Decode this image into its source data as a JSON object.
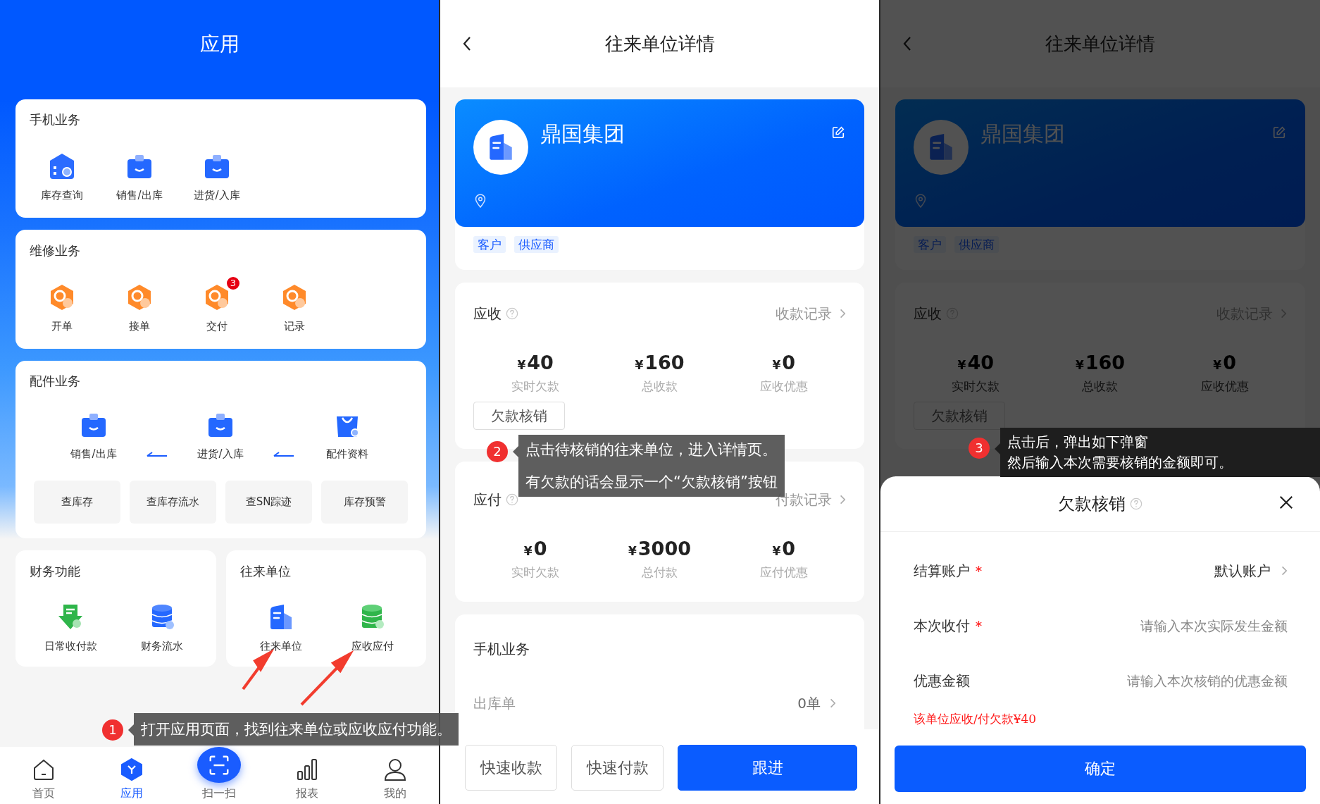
{
  "app_screen": {
    "title": "应用",
    "sections": [
      {
        "kind": "grid",
        "title": "手机业务",
        "items": [
          {
            "label": "库存查询",
            "kind": "house"
          },
          {
            "label": "销售/出库",
            "kind": "box"
          },
          {
            "label": "进货/入库",
            "kind": "box"
          }
        ]
      },
      {
        "kind": "grid",
        "title": "维修业务",
        "items": [
          {
            "label": "开单",
            "kind": "hex"
          },
          {
            "label": "接单",
            "kind": "hex"
          },
          {
            "label": "交付",
            "kind": "hex",
            "badge": "3"
          },
          {
            "label": "记录",
            "kind": "hex"
          }
        ]
      },
      {
        "kind": "flow",
        "title": "配件业务",
        "items": [
          {
            "label": "销售/出库",
            "kind": "box"
          },
          {
            "label": "进货/入库",
            "kind": "box"
          },
          {
            "label": "配件资料",
            "kind": "bag"
          }
        ],
        "buttons": [
          "查库存",
          "查库存流水",
          "查SN踪迹",
          "库存预警"
        ]
      }
    ],
    "half_sections": [
      {
        "title": "财务功能",
        "items": [
          {
            "label": "日常收付款",
            "kind": "download"
          },
          {
            "label": "财务流水",
            "kind": "database"
          }
        ]
      },
      {
        "title": "往来单位",
        "items": [
          {
            "label": "往来单位",
            "kind": "building"
          },
          {
            "label": "应收应付",
            "kind": "coins"
          }
        ]
      }
    ],
    "nav": [
      {
        "label": "首页",
        "kind": "home",
        "selected": false
      },
      {
        "label": "应用",
        "kind": "apps",
        "selected": true
      },
      {
        "label": "扫一扫",
        "kind": "scan",
        "selected": false
      },
      {
        "label": "报表",
        "kind": "chart",
        "selected": false
      },
      {
        "label": "我的",
        "kind": "user",
        "selected": false
      }
    ]
  },
  "detail_screen": {
    "title": "往来单位详情",
    "company": {
      "name": "鼎国集团",
      "tags": [
        "客户",
        "供应商"
      ]
    },
    "receivable": {
      "title": "应收",
      "link": "收款记录",
      "stats": [
        {
          "currency": "¥",
          "amount": "40",
          "label": "实时欠款"
        },
        {
          "currency": "¥",
          "amount": "160",
          "label": "总收款"
        },
        {
          "currency": "¥",
          "amount": "0",
          "label": "应收优惠"
        }
      ],
      "action": "欠款核销"
    },
    "payable": {
      "title": "应付",
      "link": "付款记录",
      "stats": [
        {
          "currency": "¥",
          "amount": "0",
          "label": "实时欠款"
        },
        {
          "currency": "¥",
          "amount": "3000",
          "label": "总付款"
        },
        {
          "currency": "¥",
          "amount": "0",
          "label": "应付优惠"
        }
      ]
    },
    "business": {
      "title": "手机业务",
      "rows": [
        {
          "label": "出库单",
          "value": "0单"
        }
      ]
    },
    "buttons": [
      {
        "label": "快速收款",
        "primary": false
      },
      {
        "label": "快速付款",
        "primary": false
      },
      {
        "label": "跟进",
        "primary": true
      }
    ]
  },
  "writeoff_screen": {
    "title": "往来单位详情",
    "company": {
      "name": "鼎国集团",
      "tags": [
        "客户",
        "供应商"
      ]
    },
    "receivable": {
      "title": "应收",
      "link": "收款记录",
      "stats": [
        {
          "currency": "¥",
          "amount": "40",
          "label": "实时欠款"
        },
        {
          "currency": "¥",
          "amount": "160",
          "label": "总收款"
        },
        {
          "currency": "¥",
          "amount": "0",
          "label": "应收优惠"
        }
      ],
      "action": "欠款核销"
    },
    "dialog": {
      "title": "欠款核销",
      "fields": [
        {
          "label": "结算账户",
          "required": true,
          "kind": "select",
          "value": "默认账户"
        },
        {
          "label": "本次收付",
          "required": true,
          "kind": "input",
          "placeholder": "请输入本次实际发生金额"
        },
        {
          "label": "优惠金额",
          "required": false,
          "kind": "input",
          "placeholder": "请输入本次核销的优惠金额"
        }
      ],
      "note": "该单位应收/付欠款¥40",
      "confirm": "确定"
    }
  },
  "annotations": [
    {
      "number": "1",
      "lines": [
        "打开应用页面，找到往来单位或应收应付功能。"
      ]
    },
    {
      "number": "2",
      "lines": [
        "点击待核销的往来单位，进入详情页。",
        "有欠款的话会显示一个“欠款核销”按钮"
      ]
    },
    {
      "number": "3",
      "lines": [
        "点击后，弹出如下弹窗",
        "然后输入本次需要核销的金额即可。"
      ]
    }
  ]
}
